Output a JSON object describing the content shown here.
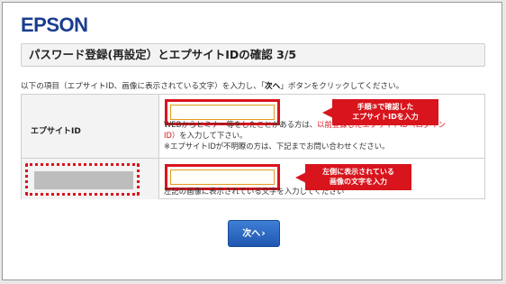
{
  "brand": {
    "logo_text": "EPSON"
  },
  "header": {
    "title": "パスワード登録(再設定）とエプサイトIDの確認 3/5"
  },
  "instruction": {
    "before": "以下の項目（エプサイトID、画像に表示されている文字）を入力し、「",
    "button_ref": "次へ",
    "after": "」ボタンをクリックしてください。"
  },
  "form": {
    "epsite_id": {
      "label": "エプサイトID",
      "value": "",
      "help_line1_prefix": "WEBからヒミナー等をしたことがある方は、",
      "help_line1_link": "以前登録したエプサイトID（ログイン",
      "help_line2_link": "ID）",
      "help_line2_suffix": "を入力して下さい。",
      "help_line3": "※エプサイトIDが不明瞭の方は、下記までお問い合わせください。"
    },
    "captcha": {
      "value": "",
      "help": "左記の画像に表示されている文字を入力してください"
    }
  },
  "annotations": {
    "callout1_line1": "手順③で確認した",
    "callout1_line2": "エプサイトIDを入力",
    "callout2_line1": "左側に表示されている",
    "callout2_line2": "画像の文字を入力"
  },
  "actions": {
    "next_label": "次へ",
    "next_chevron": "›"
  },
  "colors": {
    "accent_red": "#d8141c",
    "brand_blue": "#1a3d8f",
    "button_blue": "#2a67c4"
  }
}
